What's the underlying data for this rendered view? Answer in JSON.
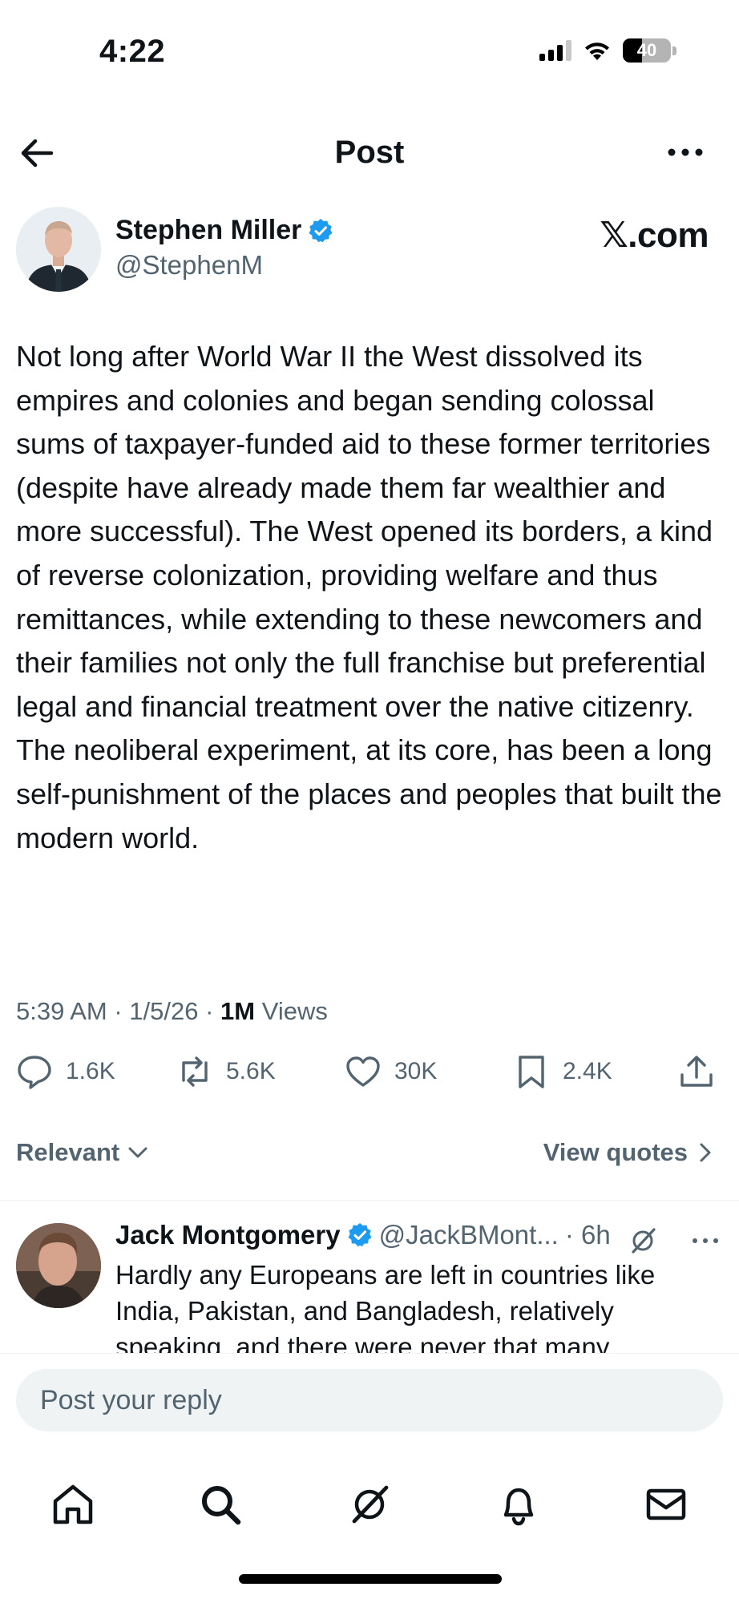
{
  "status_bar": {
    "time": "4:22",
    "battery_level": "40",
    "battery_fraction": 0.4,
    "icons": [
      "cellular-signal-icon",
      "wifi-icon",
      "battery-icon"
    ]
  },
  "header": {
    "title": "Post",
    "back_icon": "arrow-left-icon",
    "more_icon": "more-horizontal-icon"
  },
  "post": {
    "author_name": "Stephen Miller",
    "author_handle": "@StephenM",
    "verified": true,
    "source_label": "𝕏.com",
    "text": "Not long after World War II the West dissolved its empires and colonies and began sending colossal sums of taxpayer-funded aid to these former territories (despite have already made them far wealthier and more successful). The West opened its borders, a kind of reverse colonization, providing welfare and thus remittances, while extending to these newcomers and their families not only the full franchise but preferential legal and financial treatment over the native citizenry. The neoliberal experiment, at its core, has been a long self-punishment of the places and peoples that built the modern world.",
    "timestamp": "5:39 AM · 1/5/26 · ",
    "views_count": "1M",
    "views_label": " Views",
    "stats": {
      "replies": "1.6K",
      "reposts": "5.6K",
      "likes": "30K",
      "bookmarks": "2.4K"
    }
  },
  "sort": {
    "label": "Relevant",
    "quotes_label": "View quotes"
  },
  "reply": {
    "author_name": "Jack Montgomery",
    "author_handle": "@JackBMont...",
    "time": "· 6h",
    "text": "Hardly any Europeans are left in countries like India, Pakistan, and Bangladesh, relatively speaking, and there were never that many"
  },
  "composer": {
    "placeholder": "Post your reply"
  },
  "tabbar": {
    "tabs": [
      "home-icon",
      "search-icon",
      "grok-icon",
      "notifications-bell-icon",
      "messages-envelope-icon"
    ]
  },
  "colors": {
    "text_primary": "#0f1419",
    "text_secondary": "#536471",
    "verified_blue": "#1d9bf0",
    "composer_bg": "#eff3f4"
  }
}
